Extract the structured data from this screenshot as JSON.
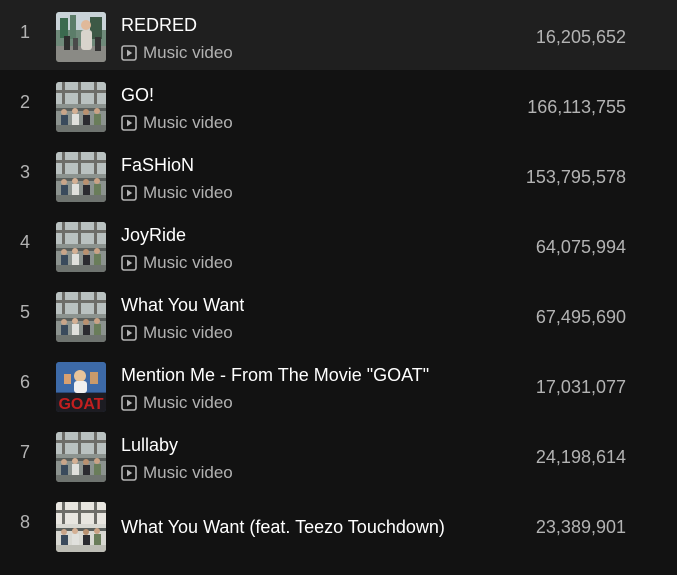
{
  "tracks": [
    {
      "index": "1",
      "title": "REDRED",
      "subtitle": "Music video",
      "plays": "16,205,652",
      "thumb": "street-photo"
    },
    {
      "index": "2",
      "title": "GO!",
      "subtitle": "Music video",
      "plays": "166,113,755",
      "thumb": "group-photo"
    },
    {
      "index": "3",
      "title": "FaSHioN",
      "subtitle": "Music video",
      "plays": "153,795,578",
      "thumb": "group-photo"
    },
    {
      "index": "4",
      "title": "JoyRide",
      "subtitle": "Music video",
      "plays": "64,075,994",
      "thumb": "group-photo"
    },
    {
      "index": "5",
      "title": "What You Want",
      "subtitle": "Music video",
      "plays": "67,495,690",
      "thumb": "group-photo"
    },
    {
      "index": "6",
      "title": "Mention Me - From The Movie \"GOAT\"",
      "subtitle": "Music video",
      "plays": "17,031,077",
      "thumb": "goat-art"
    },
    {
      "index": "7",
      "title": "Lullaby",
      "subtitle": "Music video",
      "plays": "24,198,614",
      "thumb": "group-photo"
    },
    {
      "index": "8",
      "title": "What You Want (feat. Teezo Touchdown)",
      "subtitle": "",
      "plays": "23,389,901",
      "thumb": "group-photo-light"
    }
  ],
  "colors": {
    "background": "#121212",
    "primary_text": "#ffffff",
    "secondary_text": "#b3b3b3",
    "goat_red": "#c21f1f"
  },
  "icons": {
    "music_video": "play-box-icon"
  }
}
